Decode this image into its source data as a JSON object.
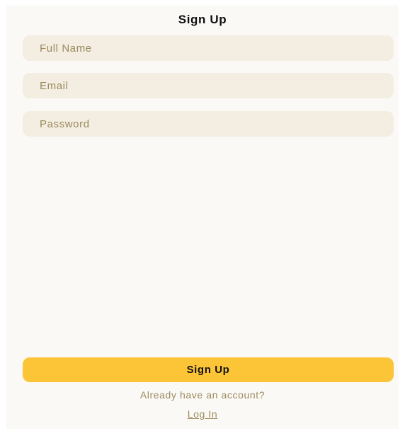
{
  "screen": {
    "title": "Sign Up"
  },
  "form": {
    "full_name": {
      "placeholder": "Full Name",
      "value": ""
    },
    "email": {
      "placeholder": "Email",
      "value": ""
    },
    "password": {
      "placeholder": "Password",
      "value": ""
    }
  },
  "actions": {
    "submit_label": "Sign Up",
    "login_prompt": "Already have an account?",
    "login_link": "Log In"
  },
  "colors": {
    "background": "#fbf9f6",
    "field_background": "#f3ede2",
    "placeholder_text": "#9c8a5c",
    "accent": "#fbc537",
    "title_text": "#111111"
  }
}
